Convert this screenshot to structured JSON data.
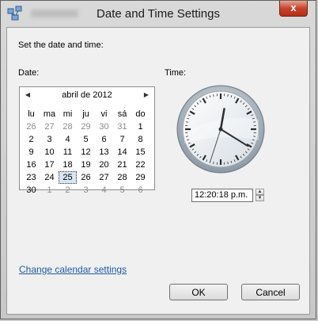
{
  "window": {
    "title": "Date and Time Settings",
    "close_label": "x"
  },
  "intro": "Set the date and time:",
  "date_label": "Date:",
  "time_label": "Time:",
  "calendar": {
    "month": "abril de 2012",
    "weekdays": [
      "lu",
      "ma",
      "mi",
      "ju",
      "vi",
      "sá",
      "do"
    ],
    "weeks": [
      [
        {
          "d": "26",
          "m": true
        },
        {
          "d": "27",
          "m": true
        },
        {
          "d": "28",
          "m": true
        },
        {
          "d": "29",
          "m": true
        },
        {
          "d": "30",
          "m": true
        },
        {
          "d": "31",
          "m": true
        },
        {
          "d": "1"
        }
      ],
      [
        {
          "d": "2"
        },
        {
          "d": "3"
        },
        {
          "d": "4"
        },
        {
          "d": "5"
        },
        {
          "d": "6"
        },
        {
          "d": "7"
        },
        {
          "d": "8"
        }
      ],
      [
        {
          "d": "9"
        },
        {
          "d": "10"
        },
        {
          "d": "11"
        },
        {
          "d": "12"
        },
        {
          "d": "13"
        },
        {
          "d": "14"
        },
        {
          "d": "15"
        }
      ],
      [
        {
          "d": "16"
        },
        {
          "d": "17"
        },
        {
          "d": "18"
        },
        {
          "d": "19"
        },
        {
          "d": "20"
        },
        {
          "d": "21"
        },
        {
          "d": "22"
        }
      ],
      [
        {
          "d": "23"
        },
        {
          "d": "24"
        },
        {
          "d": "25",
          "sel": true
        },
        {
          "d": "26"
        },
        {
          "d": "27"
        },
        {
          "d": "28"
        },
        {
          "d": "29"
        }
      ],
      [
        {
          "d": "30"
        },
        {
          "d": "1",
          "m": true
        },
        {
          "d": "2",
          "m": true
        },
        {
          "d": "3",
          "m": true
        },
        {
          "d": "4",
          "m": true
        },
        {
          "d": "5",
          "m": true
        },
        {
          "d": "6",
          "m": true
        }
      ]
    ]
  },
  "clock": {
    "hours": 12,
    "minutes": 20,
    "seconds": 18
  },
  "time_value": "12:20:18 p.m.",
  "change_calendar_link": "Change calendar settings",
  "buttons": {
    "ok": "OK",
    "cancel": "Cancel"
  }
}
